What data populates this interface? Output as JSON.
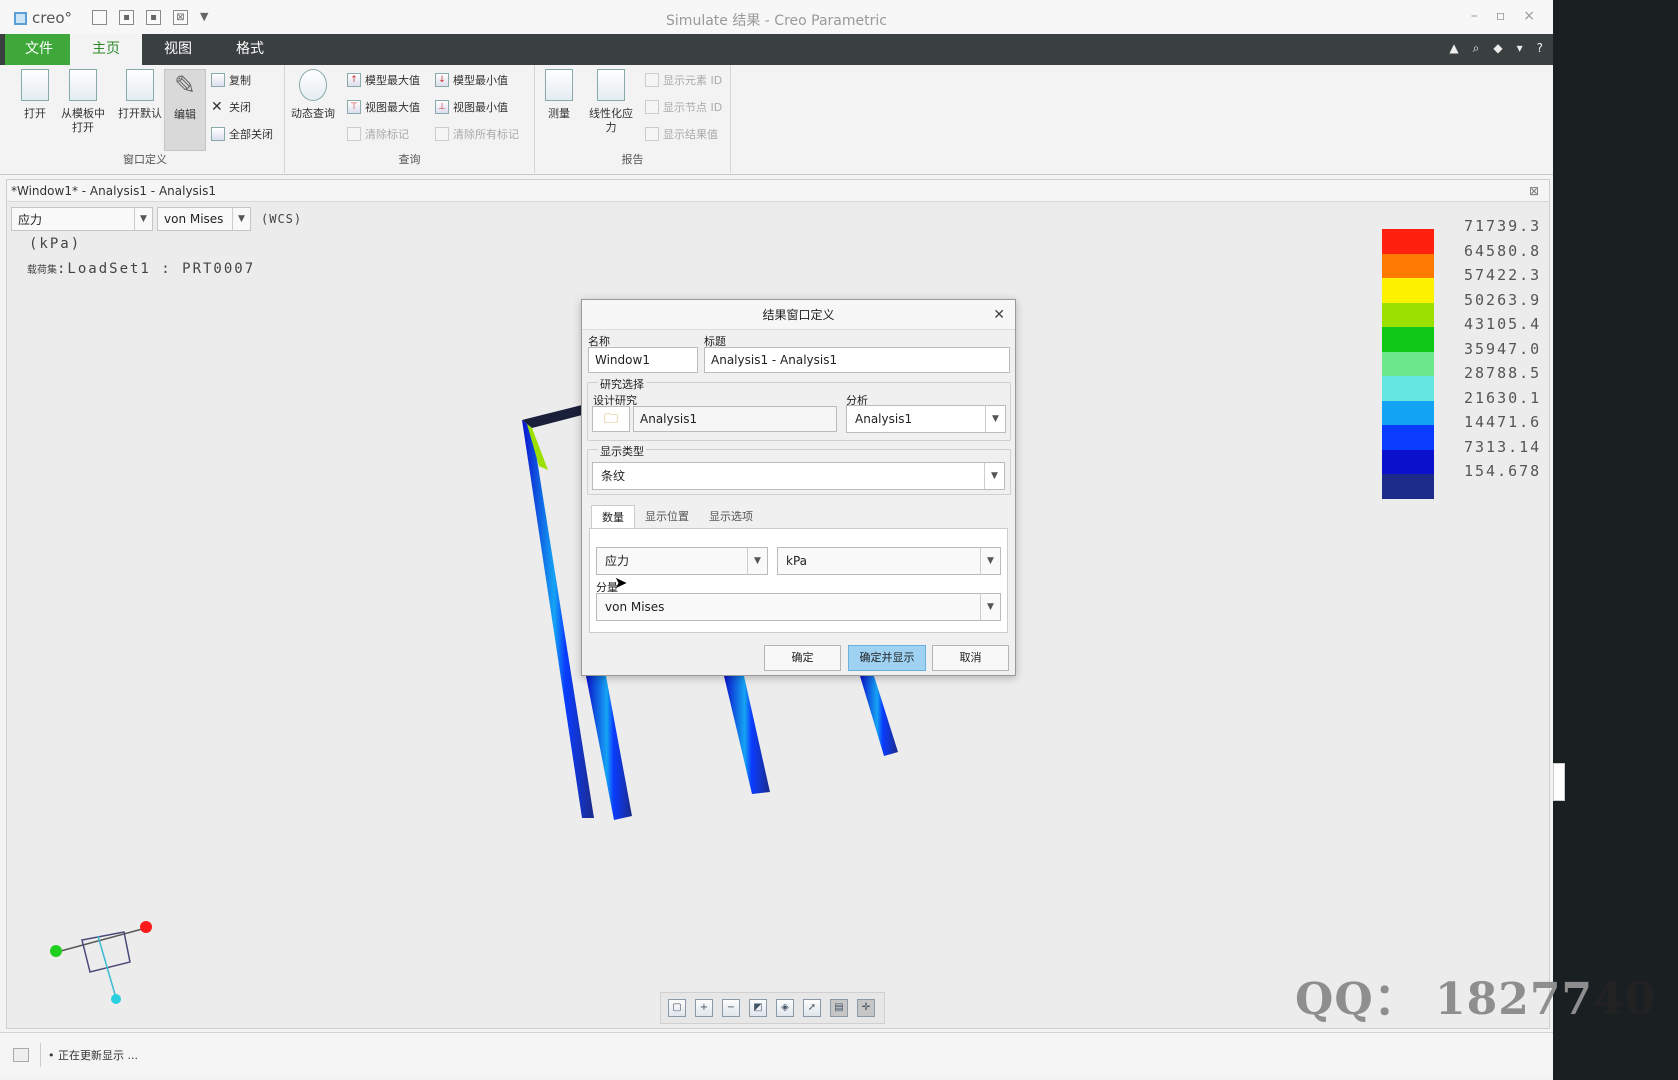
{
  "window": {
    "logo": "creo°",
    "title": "Simulate 结果 - Creo Parametric",
    "qat_icons": [
      "new-file-icon",
      "save-icon",
      "save-as-icon",
      "close-window-icon",
      "customize-icon"
    ],
    "controls": [
      "–",
      "▫",
      "×"
    ]
  },
  "menu": {
    "file": "文件",
    "tabs": [
      "主页",
      "视图",
      "格式"
    ],
    "active_tab": "主页",
    "right_icons": [
      "▲",
      "⌕",
      "◆",
      "▾",
      "?"
    ]
  },
  "ribbon": {
    "group1": {
      "label": "窗口定义",
      "open": "打开",
      "from_template_1": "从模板中",
      "from_template_2": "打开",
      "open_default": "打开默认",
      "edit": "编辑",
      "copy": "复制",
      "close": "关闭",
      "close_all": "全部关闭"
    },
    "group2": {
      "label": "查询",
      "dynamic_query": "动态查询",
      "model_max": "模型最大值",
      "model_min": "模型最小值",
      "view_max": "视图最大值",
      "view_min": "视图最小值",
      "clear_mark": "清除标记",
      "clear_all_marks": "清除所有标记"
    },
    "group3": {
      "label": "报告",
      "measure": "测量",
      "linearize_1": "线性化应",
      "linearize_2": "力",
      "show_element_id": "显示元素 ID",
      "show_node_id": "显示节点 ID",
      "show_result_value": "显示结果值"
    }
  },
  "viewport": {
    "title": "*Window1* - Analysis1 - Analysis1",
    "quantity": "应力",
    "component": "von Mises",
    "wcs": "(WCS)",
    "unit": "(kPa)",
    "loadset_prefix": "载荷集",
    "loadset": ":LoadSet1 :   PRT0007"
  },
  "legend": {
    "colors": [
      "#ff2010",
      "#ff7a00",
      "#fff200",
      "#9be000",
      "#10c818",
      "#6de88a",
      "#66e6e0",
      "#14a4f4",
      "#0a3cff",
      "#0b10cc",
      "#1c2b8a"
    ],
    "values": [
      "71739.3",
      "64580.8",
      "57422.3",
      "50263.9",
      "43105.4",
      "35947.0",
      "28788.5",
      "21630.1",
      "14471.6",
      "7313.14",
      "154.678"
    ]
  },
  "dialog": {
    "title": "结果窗口定义",
    "name_label": "名称",
    "name_value": "Window1",
    "title_label": "标题",
    "title_value": "Analysis1 - Analysis1",
    "study_section": "研究选择",
    "design_study_label": "设计研究",
    "design_study_value": "Analysis1",
    "analysis_label": "分析",
    "analysis_value": "Analysis1",
    "display_type_label": "显示类型",
    "display_type_value": "条纹",
    "tabs": [
      "数量",
      "显示位置",
      "显示选项"
    ],
    "active_tab": "数量",
    "quantity_value": "应力",
    "unit_value": "kPa",
    "component_label": "分量",
    "component_value": "von Mises",
    "ok": "确定",
    "ok_show": "确定并显示",
    "cancel": "取消"
  },
  "zoom_toolbar": [
    "refit-icon",
    "zoom-in-icon",
    "zoom-out-icon",
    "repaint-icon",
    "saved-orientations-icon",
    "display-style-icon",
    "view-manager-icon",
    "spin-center-icon"
  ],
  "status": {
    "text": "• 正在更新显示 ..."
  },
  "watermark": {
    "text": "QQ：  18277",
    "tail": "40"
  }
}
